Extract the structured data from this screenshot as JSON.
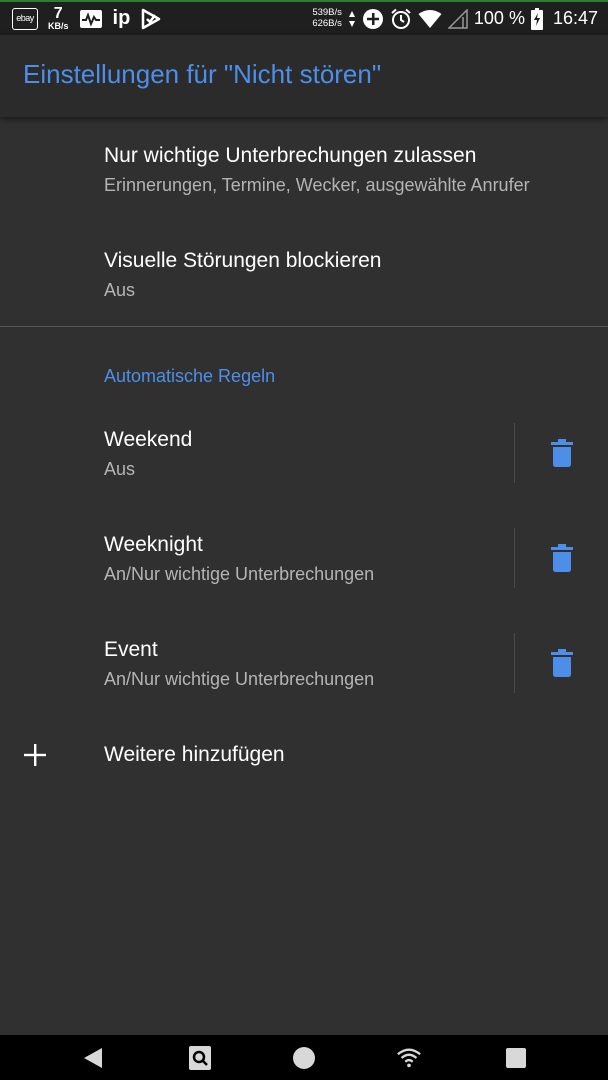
{
  "status_bar": {
    "ebay_label": "ebay",
    "net_speed_value": "7",
    "net_speed_unit": "KB/s",
    "ip_label": "ip",
    "upload_speed": "539B/s",
    "download_speed": "626B/s",
    "battery_percent": "100 %",
    "clock": "16:47"
  },
  "app_bar": {
    "title": "Einstellungen für \"Nicht stören\""
  },
  "settings": {
    "priority": {
      "title": "Nur wichtige Unterbrechungen zulassen",
      "summary": "Erinnerungen, Termine, Wecker, ausgewählte Anrufer"
    },
    "visual": {
      "title": "Visuelle Störungen blockieren",
      "summary": "Aus"
    }
  },
  "rules": {
    "category": "Automatische Regeln",
    "items": [
      {
        "title": "Weekend",
        "summary": "Aus"
      },
      {
        "title": "Weeknight",
        "summary": "An/Nur wichtige Unterbrechungen"
      },
      {
        "title": "Event",
        "summary": "An/Nur wichtige Unterbrechungen"
      }
    ],
    "add_label": "Weitere hinzufügen"
  },
  "colors": {
    "accent": "#4d8fe8",
    "background": "#303030",
    "app_bar": "#2b2b2b",
    "status_bar": "#1f1f1f",
    "summary_text": "#b4b4b4"
  },
  "icons": {
    "status_bar": [
      "ebay-icon",
      "pulse-icon",
      "ip-icon",
      "play-check-icon",
      "data-arrows-icon",
      "add-circle-icon",
      "alarm-icon",
      "wifi-icon",
      "signal-icon",
      "battery-charging-icon"
    ],
    "rules": [
      "trash-icon",
      "plus-icon"
    ],
    "nav_bar": [
      "back-icon",
      "search-icon",
      "home-icon",
      "wifi-icon",
      "recents-icon"
    ]
  }
}
